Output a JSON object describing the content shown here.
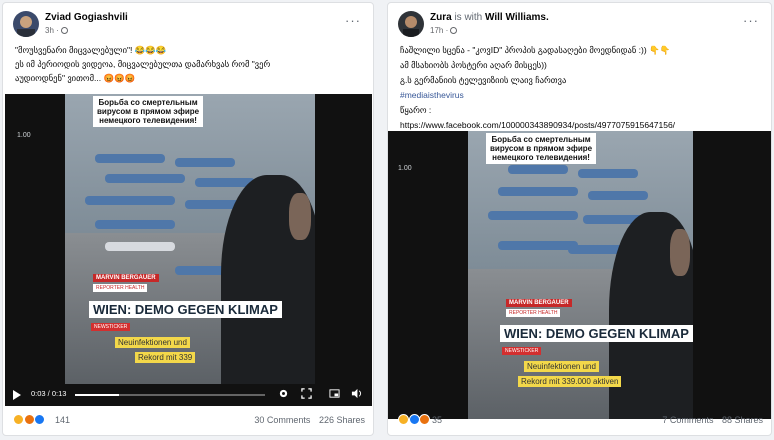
{
  "colors": {
    "accent": "#385898",
    "like": "#1877f2",
    "haha": "#f7b125",
    "angry": "#e9710f",
    "love": "#f33e58"
  },
  "posts": [
    {
      "author": "Zviad Gogiashvili",
      "with_text": "",
      "with_name": "",
      "time": "3h ·",
      "lines": [
        "\"მოუსვენარი მიცვალებული\"! 😂😂😂",
        "ეს იმ პერიოდის ვიდეოა, მიცვალებულთა დამარხვას რომ \"ვერ",
        "აუდიოდნენ\" ვითომ... 😡😡😡"
      ],
      "video": {
        "caption": [
          "Борьба со смертельным",
          "вирусом в прямом эфире",
          "немецкого телевидения!"
        ],
        "side_label": "1.00",
        "ticker_name": "MARVIN BERGAUER",
        "ticker_role": "REPORTER HEALTH",
        "headline": "WIEN: DEMO GEGEN KLIMAP",
        "news_tag": "NEWSTICKER",
        "subline_1": "Neuinfektionen und",
        "subline_2": "Rekord mit 339",
        "time": "0:03 / 0:13",
        "progress": 0.23
      },
      "reaction_count": "141",
      "comments": "30 Comments",
      "shares": "226 Shares"
    },
    {
      "author": "Zura",
      "with_text": " is with ",
      "with_name": "Will Williams.",
      "time": "17h ·",
      "lines": [
        "ჩაშლილი სცენა - \"კოვID\" პროპის გადასაღები მოედნიდან :)) 👇👇",
        "ამ მსახიობს პოსტერი აღარ მისცეს))",
        "გ.ს გერმანიის ტელევიზიის ლაივ ჩართვა"
      ],
      "hashtag": "#mediaisthevirus",
      "source_label": "წყარო :",
      "url": "https://www.facebook.com/100000343890934/posts/4977075915647156/",
      "video": {
        "caption": [
          "Борьба со смертельным",
          "вирусом в прямом эфире",
          "немецкого телевидения!"
        ],
        "side_label": "1.00",
        "ticker_name": "MARVIN BERGAUER",
        "ticker_role": "REPORTER HEALTH",
        "headline": "WIEN: DEMO GEGEN KLIMAP",
        "news_tag": "NEWSTICKER",
        "subline_1": "Neuinfektionen und",
        "subline_2": "Rekord mit 339.000 aktiven"
      },
      "reaction_count": "35",
      "comments": "7 Comments",
      "shares": "88 Shares"
    }
  ]
}
